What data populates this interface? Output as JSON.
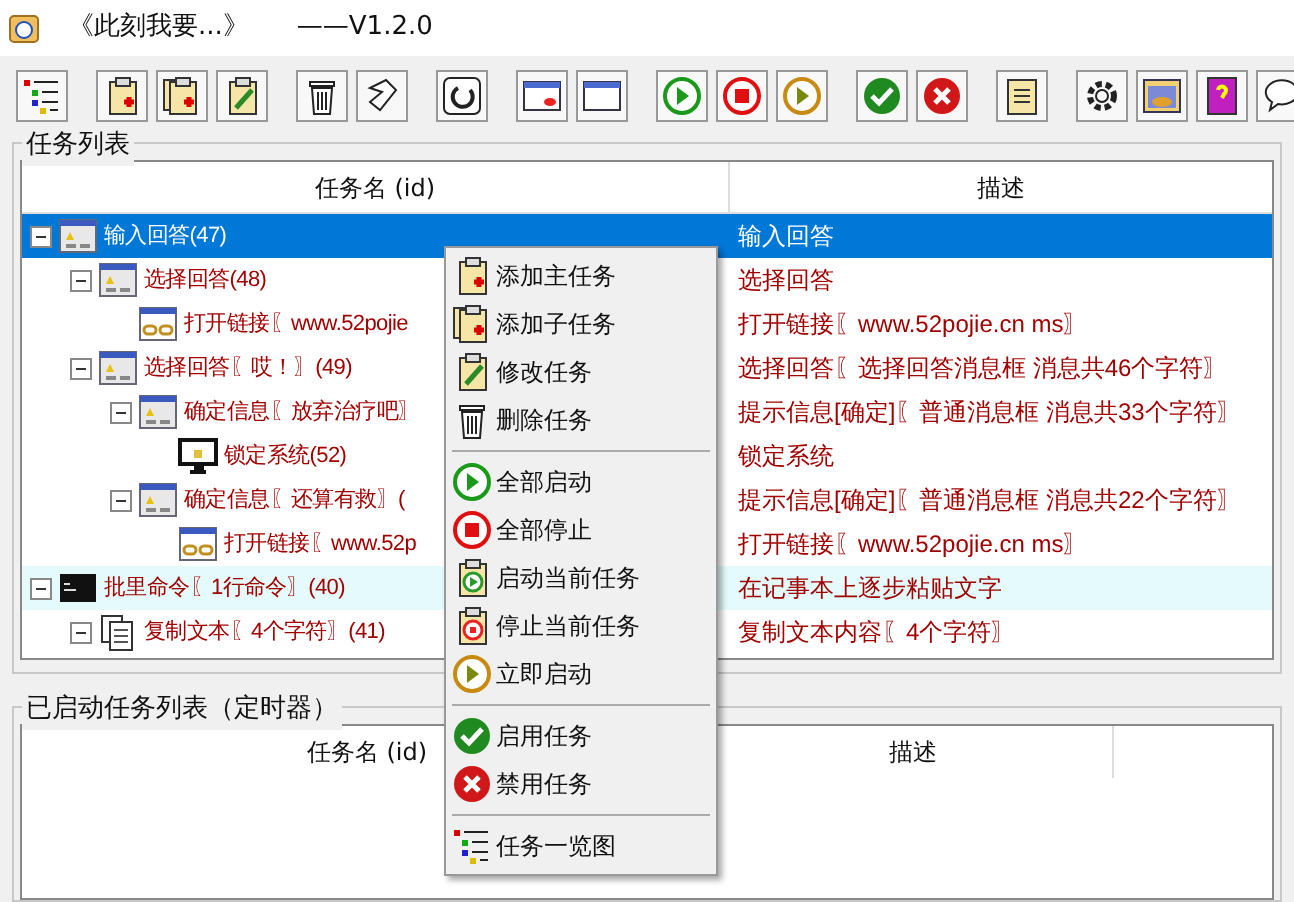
{
  "window": {
    "title": "《此刻我要...》",
    "version": "——V1.2.0"
  },
  "task_list": {
    "title": "任务列表",
    "columns": [
      "任务名 (id)",
      "描述"
    ],
    "rows": [
      {
        "kind": "dialog",
        "name": "输入回答(47)",
        "description": "输入回答",
        "selected": true,
        "highlighted": false,
        "expanded": true,
        "children": [
          {
            "kind": "dialog",
            "name": "选择回答(48)",
            "description": "选择回答",
            "selected": false,
            "highlighted": false,
            "expanded": true,
            "children": [
              {
                "kind": "link",
                "name": "打开链接〖www.52pojie",
                "description": "打开链接〖www.52pojie.cn ms〗",
                "selected": false,
                "highlighted": false
              }
            ]
          },
          {
            "kind": "dialog",
            "name": "选择回答〖哎！〗(49)",
            "description": "选择回答〖选择回答消息框 消息共46个字符〗",
            "selected": false,
            "highlighted": false,
            "expanded": true,
            "children": [
              {
                "kind": "dialog",
                "name": "确定信息〖放弃治疗吧〗",
                "description": "提示信息[确定]〖普通消息框 消息共33个字符〗",
                "selected": false,
                "highlighted": false,
                "expanded": true,
                "children": [
                  {
                    "kind": "lock",
                    "name": "锁定系统(52)",
                    "description": "锁定系统",
                    "selected": false,
                    "highlighted": false
                  }
                ]
              },
              {
                "kind": "dialog",
                "name": "确定信息〖还算有救〗(",
                "description": "提示信息[确定]〖普通消息框 消息共22个字符〗",
                "selected": false,
                "highlighted": false,
                "expanded": true,
                "children": [
                  {
                    "kind": "link",
                    "name": "打开链接〖www.52p",
                    "description": "打开链接〖www.52pojie.cn ms〗",
                    "selected": false,
                    "highlighted": false
                  }
                ]
              }
            ]
          }
        ]
      },
      {
        "kind": "cmd",
        "name": "批里命令〖1行命令〗(40)",
        "description": "在记事本上逐步粘贴文字",
        "selected": false,
        "highlighted": true,
        "expanded": true,
        "children": [
          {
            "kind": "copy",
            "name": "复制文本〖4个字符〗(41)",
            "description": "复制文本内容〖4个字符〗",
            "selected": false,
            "highlighted": false,
            "expanded": true
          }
        ]
      }
    ]
  },
  "timer_list": {
    "title": "已启动任务列表（定时器）",
    "columns": [
      "任务名 (id)",
      "描述"
    ]
  },
  "context_menu": [
    {
      "kind": "add",
      "label": "添加主任务"
    },
    {
      "kind": "addsub",
      "label": "添加子任务"
    },
    {
      "kind": "edit",
      "label": "修改任务"
    },
    {
      "kind": "delete",
      "label": "删除任务"
    },
    {
      "kind": "separator"
    },
    {
      "kind": "play",
      "label": "全部启动"
    },
    {
      "kind": "stop",
      "label": "全部停止"
    },
    {
      "kind": "clipplay",
      "label": "启动当前任务"
    },
    {
      "kind": "clipstop",
      "label": "停止当前任务"
    },
    {
      "kind": "playnow",
      "label": "立即启动"
    },
    {
      "kind": "separator"
    },
    {
      "kind": "check",
      "label": "启用任务"
    },
    {
      "kind": "cross",
      "label": "禁用任务"
    },
    {
      "kind": "separator"
    },
    {
      "kind": "tree",
      "label": "任务一览图"
    }
  ]
}
